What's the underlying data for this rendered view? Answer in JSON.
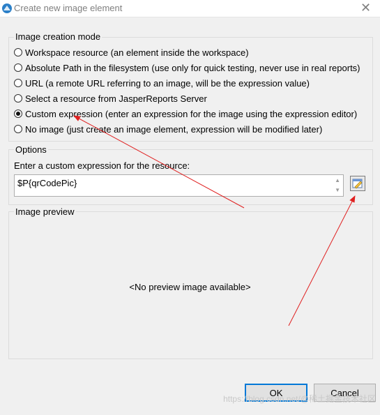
{
  "window": {
    "title": "Create new image element",
    "close_symbol": "✕"
  },
  "creation_mode": {
    "group_label": "Image creation mode",
    "options": [
      {
        "label": "Workspace resource (an element inside the workspace)",
        "checked": false
      },
      {
        "label": "Absolute Path in the filesystem (use only for quick testing, never use in real reports)",
        "checked": false
      },
      {
        "label": "URL (a remote URL referring to an image, will be the expression value)",
        "checked": false
      },
      {
        "label": "Select a resource from JasperReports Server",
        "checked": false
      },
      {
        "label": "Custom expression (enter an expression for the image using the expression editor)",
        "checked": true
      },
      {
        "label": "No image (just create an image element, expression will be modified later)",
        "checked": false
      }
    ]
  },
  "options": {
    "group_label": "Options",
    "expression_label": "Enter a custom expression for the resource:",
    "expression_value": "$P{qrCodePic}"
  },
  "preview": {
    "group_label": "Image preview",
    "empty_text": "<No preview image available>"
  },
  "buttons": {
    "ok": "OK",
    "cancel": "Cancel"
  },
  "watermark": "https://blog.csdn.net/@稀土掘金技术社区",
  "colors": {
    "accent": "#0078d7",
    "annotation_arrow": "#e02020"
  }
}
